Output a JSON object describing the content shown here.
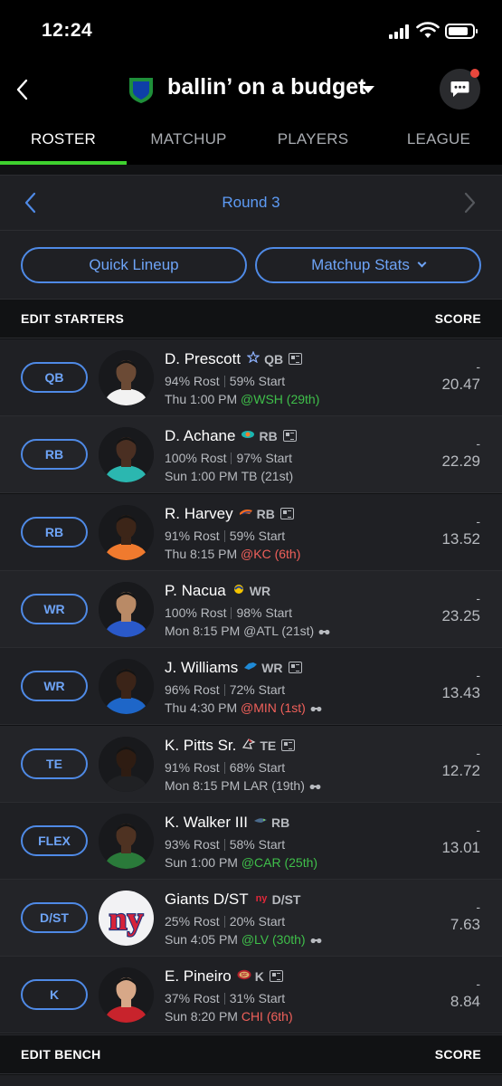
{
  "status": {
    "time": "12:24"
  },
  "header": {
    "title": "ballin’ on a budget"
  },
  "tabs": [
    "ROSTER",
    "MATCHUP",
    "PLAYERS",
    "LEAGUE"
  ],
  "round": {
    "label": "Round 3"
  },
  "actions": {
    "quick_lineup": "Quick Lineup",
    "matchup_stats": "Matchup Stats"
  },
  "starters_header": {
    "left": "EDIT STARTERS",
    "right": "SCORE"
  },
  "bench_header": {
    "left": "EDIT BENCH",
    "right": "SCORE"
  },
  "colors": {
    "accent_blue": "#4f8ae6",
    "active_tab": "#3fd12f",
    "good_matchup": "#3fbf4a",
    "bad_matchup": "#f0605a"
  },
  "players": [
    {
      "slot": "QB",
      "name": "D. Prescott",
      "team_icon": "star-icon",
      "pos": "QB",
      "news": true,
      "rost": "94% Rost",
      "start": "59% Start",
      "time": "Thu 1:00 PM",
      "opp": "@WSH (29th)",
      "opp_tone": "good",
      "glasses": false,
      "dash": "-",
      "score": "20.47"
    },
    {
      "slot": "RB",
      "name": "D. Achane",
      "team_icon": "dolphin-icon",
      "pos": "RB",
      "news": true,
      "rost": "100% Rost",
      "start": "97% Start",
      "time": "Sun 1:00 PM",
      "opp": "TB (21st)",
      "opp_tone": "neutral",
      "glasses": false,
      "dash": "-",
      "score": "22.29"
    },
    {
      "slot": "RB",
      "name": "R. Harvey",
      "team_icon": "bronco-icon",
      "pos": "RB",
      "news": true,
      "rost": "91% Rost",
      "start": "59% Start",
      "time": "Thu 8:15 PM",
      "opp": "@KC (6th)",
      "opp_tone": "bad",
      "glasses": false,
      "dash": "-",
      "score": "13.52"
    },
    {
      "slot": "WR",
      "name": "P. Nacua",
      "team_icon": "ram-icon",
      "pos": "WR",
      "news": false,
      "rost": "100% Rost",
      "start": "98% Start",
      "time": "Mon 8:15 PM",
      "opp": "@ATL (21st)",
      "opp_tone": "neutral",
      "glasses": true,
      "dash": "-",
      "score": "23.25"
    },
    {
      "slot": "WR",
      "name": "J. Williams",
      "team_icon": "lion-icon",
      "pos": "WR",
      "news": true,
      "rost": "96% Rost",
      "start": "72% Start",
      "time": "Thu 4:30 PM",
      "opp": "@MIN (1st)",
      "opp_tone": "bad",
      "glasses": true,
      "dash": "-",
      "score": "13.43"
    },
    {
      "slot": "TE",
      "name": "K. Pitts Sr.",
      "team_icon": "falcon-icon",
      "pos": "TE",
      "news": true,
      "rost": "91% Rost",
      "start": "68% Start",
      "time": "Mon 8:15 PM",
      "opp": "LAR (19th)",
      "opp_tone": "neutral",
      "glasses": true,
      "dash": "-",
      "score": "12.72"
    },
    {
      "slot": "FLEX",
      "name": "K. Walker III",
      "team_icon": "seahawk-icon",
      "pos": "RB",
      "news": false,
      "rost": "93% Rost",
      "start": "58% Start",
      "time": "Sun 1:00 PM",
      "opp": "@CAR (25th)",
      "opp_tone": "good",
      "glasses": false,
      "dash": "-",
      "score": "13.01"
    },
    {
      "slot": "D/ST",
      "name": "Giants D/ST",
      "team_icon": "giants-icon",
      "pos": "D/ST",
      "news": false,
      "rost": "25% Rost",
      "start": "20% Start",
      "time": "Sun 4:05 PM",
      "opp": "@LV (30th)",
      "opp_tone": "good",
      "glasses": true,
      "dash": "-",
      "score": "7.63"
    },
    {
      "slot": "K",
      "name": "E. Pineiro",
      "team_icon": "49ers-icon",
      "pos": "K",
      "news": true,
      "rost": "37% Rost",
      "start": "31% Start",
      "time": "Sun 8:20 PM",
      "opp": "CHI (6th)",
      "opp_tone": "bad",
      "glasses": false,
      "dash": "-",
      "score": "8.84"
    }
  ]
}
